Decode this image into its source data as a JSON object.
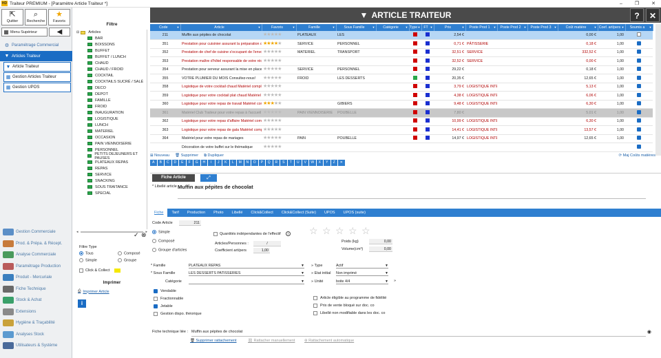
{
  "window": {
    "title": "Traiteur PREMIUM - [Paramètre Article Traiteur *]",
    "logo": "HD",
    "min": "–",
    "max": "❐",
    "close": "✕"
  },
  "toolbar": {
    "quit": "Quitter",
    "search": "Recherche",
    "fav": "Favoris",
    "menu_sup": "Menu Supérieur"
  },
  "nav": {
    "param_com": "Paramétrage Commercial",
    "articles": "Articles Traiteur",
    "sub": [
      "Article Traiteur",
      "Gestion Articles Traiteur",
      "Gestion UPOS"
    ],
    "bottom": [
      {
        "label": "Gestion Commerciale",
        "color": "#5b8fc7"
      },
      {
        "label": "Prod. & Prépa. & Récept.",
        "color": "#c77b3b"
      },
      {
        "label": "Analyse Commerciale",
        "color": "#4a9a5c"
      },
      {
        "label": "Paramétrage Production",
        "color": "#b95b5b"
      },
      {
        "label": "Produit - Mercuriale",
        "color": "#3a7fbf"
      },
      {
        "label": "Fiche Technique",
        "color": "#6a6a6a"
      },
      {
        "label": "Stock & Achat",
        "color": "#3aa06a"
      },
      {
        "label": "Extensions",
        "color": "#8a8a8a"
      },
      {
        "label": "Hygiène & Traçabilité",
        "color": "#c9a23b"
      },
      {
        "label": "Analyses Stock",
        "color": "#5b9ad0"
      },
      {
        "label": "Utilisateurs & Système",
        "color": "#4a6a9a"
      }
    ]
  },
  "filter": {
    "title": "Filtre",
    "root": "Articles",
    "nodes": [
      "BAR",
      "BOISSONS",
      "BUFFET",
      "BUFFET / LUNCH",
      "CHAUD",
      "CHAUD / FROID",
      "COCKTAIL",
      "COCKTAILS SUCRÉ / SALÉ",
      "DECO",
      "DEPOT",
      "FAMILLE",
      "FROID",
      "INAUGURATION",
      "LOGISTIQUE",
      "LUNCH",
      "MATERIEL",
      "OCCASION",
      "PAIN VIENNOISERIE",
      "PERSONNEL",
      "PETITS DEJEUNERS ET PAUSES",
      "PLATEAUX REPAS",
      "REPAS",
      "SERVICE",
      "SNACKING",
      "SOUS TRAITANCE",
      "SPECIAL"
    ],
    "type_title": "Filtre Type",
    "types": [
      "Tous",
      "Composé",
      "Simple",
      "Groupe"
    ],
    "click": "Click & Collect",
    "print_title": "Imprimer",
    "print_link": "Imprimer Article"
  },
  "header": {
    "title": "ARTICLE TRAITEUR",
    "help": "?",
    "close": "✕"
  },
  "grid": {
    "columns": [
      "Code",
      "Article",
      "Favoris",
      "Famille",
      "Sous Famille",
      "Catégorie",
      "Type",
      "FT",
      "Prix",
      "Poste Prod 1",
      "Poste Prod 2",
      "Poste Prod 3",
      "Coût matière",
      "Coef. art/pers",
      "Soumis a"
    ],
    "rows": [
      {
        "code": "211",
        "article": "Muffin aux pépites de chocolat",
        "stars": 0,
        "famille": "PLATEAUX",
        "sfam": "LES",
        "type": "#d00000",
        "ft": "#1a2fd0",
        "prix": "2,54 €",
        "p1": "",
        "cout": "0,00 €",
        "coef": "1,00",
        "chk": false,
        "red": false,
        "sel": true
      },
      {
        "code": "351",
        "article": "Prestation pour cuisinier assurant la préparation des plats",
        "stars": 4,
        "famille": "SERVICE",
        "sfam": "PERSONNEL",
        "type": "#d00000",
        "ft": "#1a2fd0",
        "prix": "0,71 €",
        "p1": "PÂTISSERIE",
        "cout": "0,18 €",
        "coef": "1,00",
        "chk": true,
        "red": true
      },
      {
        "code": "352",
        "article": "Prestation de chef de cuisine s'occupant de l'envoi de votre réception",
        "stars": 0,
        "famille": "MATERIEL",
        "sfam": "TRANSPORT",
        "type": "#d00000",
        "ft": "#1a2fd0",
        "prix": "32,51 €",
        "p1": "SERVICE",
        "cout": "332,52 €",
        "coef": "1,00",
        "chk": true,
        "red": true
      },
      {
        "code": "353",
        "article": "Prestation maître d'hôtel responsable de votre réception",
        "stars": 0,
        "famille": "",
        "sfam": "",
        "type": "#d00000",
        "ft": "#1a2fd0",
        "prix": "32,52 €",
        "p1": "SERVICE",
        "cout": "0,00 €",
        "coef": "1,00",
        "chk": true,
        "red": true
      },
      {
        "code": "354",
        "article": "Prestation pour serveur assurant la mise en place, le service et le débarrassage de votre",
        "stars": 0,
        "famille": "SERVICE",
        "sfam": "PERSONNEL",
        "type": "#d00000",
        "ft": "#1a2fd0",
        "prix": "29,22 €",
        "p1": "",
        "cout": "0,18 €",
        "coef": "1,00",
        "chk": true,
        "red": false
      },
      {
        "code": "355",
        "article": "VOTRE PLUMIER DU MOIS Consultez-nous!",
        "stars": 0,
        "famille": "FROID",
        "sfam": "LES DESSERTS",
        "type": "#2aa84a",
        "ft": "#1a2fd0",
        "prix": "20,35 €",
        "p1": "",
        "cout": "12,65 €",
        "coef": "1,00",
        "chk": true,
        "red": false
      },
      {
        "code": "358",
        "article": "Logistique de votre cocktail chaud Matériel complet pour le service et la mise en",
        "stars": 0,
        "famille": "",
        "sfam": "",
        "type": "#d00000",
        "ft": "#1a2fd0",
        "prix": "3,79 €",
        "p1": "LOGISTIQUE INTERN",
        "cout": "5,13 €",
        "coef": "1,00",
        "chk": true,
        "red": true
      },
      {
        "code": "359",
        "article": "Logistique pour votre cocktail plat chaud Matériel complet pour le service et la mise en",
        "stars": 0,
        "famille": "",
        "sfam": "",
        "type": "#d00000",
        "ft": "#1a2fd0",
        "prix": "4,38 €",
        "p1": "LOGISTIQUE INTERN",
        "cout": "6,06 €",
        "coef": "1,00",
        "chk": true,
        "red": true
      },
      {
        "code": "360",
        "article": "Logistique pour votre repas de travail Matériel complet pour le service et la mise en",
        "stars": 3,
        "famille": "",
        "sfam": "GIBIERS",
        "type": "#d00000",
        "ft": "#1a2fd0",
        "prix": "9,48 €",
        "p1": "LOGISTIQUE INTERN",
        "cout": "6,30 €",
        "coef": "1,00",
        "chk": true,
        "red": true
      },
      {
        "code": "361",
        "article": "Matériel Club Traiteur pour votre repas à l'accueil avec café",
        "stars": 0,
        "famille": "PAIN VIENNOISERIE",
        "sfam": "POUBELLE",
        "type": "#d00000",
        "ft": "#1a2fd0",
        "prix": "7,80 €",
        "p1": "",
        "cout": "5,01 €",
        "coef": "1,00",
        "chk": true,
        "red": false,
        "grey": true
      },
      {
        "code": "362",
        "article": "Logistique pour votre repas d'affaire Matériel complet pour votre repas de gala",
        "stars": 0,
        "famille": "",
        "sfam": "",
        "type": "#d00000",
        "ft": "#1a2fd0",
        "prix": "10,99 €",
        "p1": "LOGISTIQUE INTERN",
        "cout": "6,30 €",
        "coef": "1,00",
        "chk": true,
        "red": true
      },
      {
        "code": "363",
        "article": "Logistique pour votre repas de gala Matériel complet pour le service et la mise en",
        "stars": 0,
        "famille": "",
        "sfam": "",
        "type": "#d00000",
        "ft": "#1a2fd0",
        "prix": "14,41 €",
        "p1": "LOGISTIQUE INTERN",
        "cout": "13,57 €",
        "coef": "1,00",
        "chk": true,
        "red": true
      },
      {
        "code": "364",
        "article": "Matériel pour votre repas de mariages",
        "stars": 0,
        "famille": "PAIN",
        "sfam": "POUBELLE",
        "type": "#d00000",
        "ft": "#1a2fd0",
        "prix": "14,97 €",
        "p1": "LOGISTIQUE INTERN",
        "cout": "12,65 €",
        "coef": "1,00",
        "chk": true,
        "red": false
      },
      {
        "code": "",
        "article": "Décoration de votre buffet sur le thématique",
        "stars": 0,
        "famille": "",
        "sfam": "",
        "type": "",
        "ft": "",
        "prix": "",
        "p1": "",
        "cout": "",
        "coef": "",
        "chk": true,
        "red": false
      }
    ]
  },
  "actions": {
    "new": "Nouveau",
    "del": "Supprimer",
    "dup": "Dupliquer",
    "maj": "Maj Coûts matières"
  },
  "alpha": [
    "A",
    "B",
    "C",
    "D",
    "E",
    "F",
    "G",
    "H",
    "I",
    "J",
    "K",
    "L",
    "M",
    "N",
    "O",
    "P",
    "Q",
    "R",
    "S",
    "T",
    "U",
    "V",
    "W",
    "X",
    "Y",
    "Z",
    "✕"
  ],
  "fiche": {
    "tab": "Fiche Article",
    "lib_label": "* Libellé article",
    "lib_value": "Muffin aux pépites de chocolat",
    "subtabs": [
      "Fiche",
      "Tarif",
      "Production",
      "Photo",
      "Libellé",
      "Click&Collect",
      "Click&Collect (Suite)",
      "UPOS",
      "UPOS (suite)"
    ],
    "code_label": "Code Article",
    "code_value": "211",
    "r_simple": "Simple",
    "r_compose": "Composé",
    "r_groupe": "Groupe d'articles",
    "qte_label": "Quantités indépendantes de l'effectif",
    "artpers_label": "Articles/Personnes :",
    "artpers_value": "/",
    "coef_label": "Coefficient art/pers",
    "coef_value": "1,00",
    "poids_label": "Poids (kg)",
    "poids_value": "0,00",
    "vol_label": "Volume(cm³)",
    "vol_value": "0,00",
    "famille_label": "* Famille",
    "famille_value": "PLATEAUX REPAS",
    "sfam_label": "* Sous Famille",
    "sfam_value": "LES DESSERTS PATISSERIES",
    "cat_label": "Catégorie",
    "cat_value": "",
    "type_label": "Type",
    "type_value": "Actif",
    "etat_label": "Etat initial",
    "etat_value": "Non imprimé",
    "unite_label": "Unité",
    "unite_value": "boite 4/4",
    "checks_left": [
      {
        "l": "Vendable",
        "on": true
      },
      {
        "l": "Fractionnable",
        "on": false
      },
      {
        "l": "Jetable",
        "on": true
      },
      {
        "l": "Gestion dispo. théorique",
        "on": false
      }
    ],
    "checks_right": [
      "Article éligible au programme de fidélité",
      "Prix de vente bloqué sur doc. co",
      "Libellé non modifiable dans les doc. co"
    ],
    "ft_label": "Fiche technique liée :",
    "ft_value": "Muffin aux pépites de chocolat",
    "ft_del": "Supprimer rattachement",
    "ft_man": "Rattacher manuellement",
    "ft_auto": "Rattachement automatique"
  }
}
